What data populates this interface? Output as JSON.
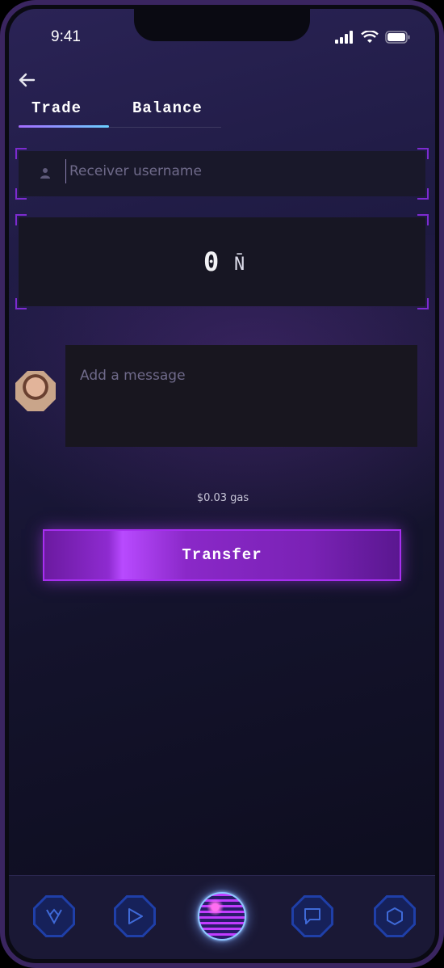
{
  "status_bar": {
    "time": "9:41"
  },
  "tabs": [
    {
      "label": "Trade",
      "active": true
    },
    {
      "label": "Balance",
      "active": false
    }
  ],
  "receiver": {
    "placeholder": "Receiver username"
  },
  "amount": {
    "value": "0",
    "unit": "N̄"
  },
  "message": {
    "placeholder": "Add a message"
  },
  "gas": "$0.03 gas",
  "transfer_label": "Transfer",
  "colors": {
    "accent": "#a72ff0",
    "tab_indicator_start": "#a46bff",
    "tab_indicator_end": "#6ad0ff",
    "nav_icon": "#1f3fa8"
  },
  "nav": [
    {
      "icon": "vault-icon"
    },
    {
      "icon": "play-icon"
    },
    {
      "icon": "globe-orb-icon",
      "active": true
    },
    {
      "icon": "chat-icon"
    },
    {
      "icon": "hexagon-icon"
    }
  ]
}
